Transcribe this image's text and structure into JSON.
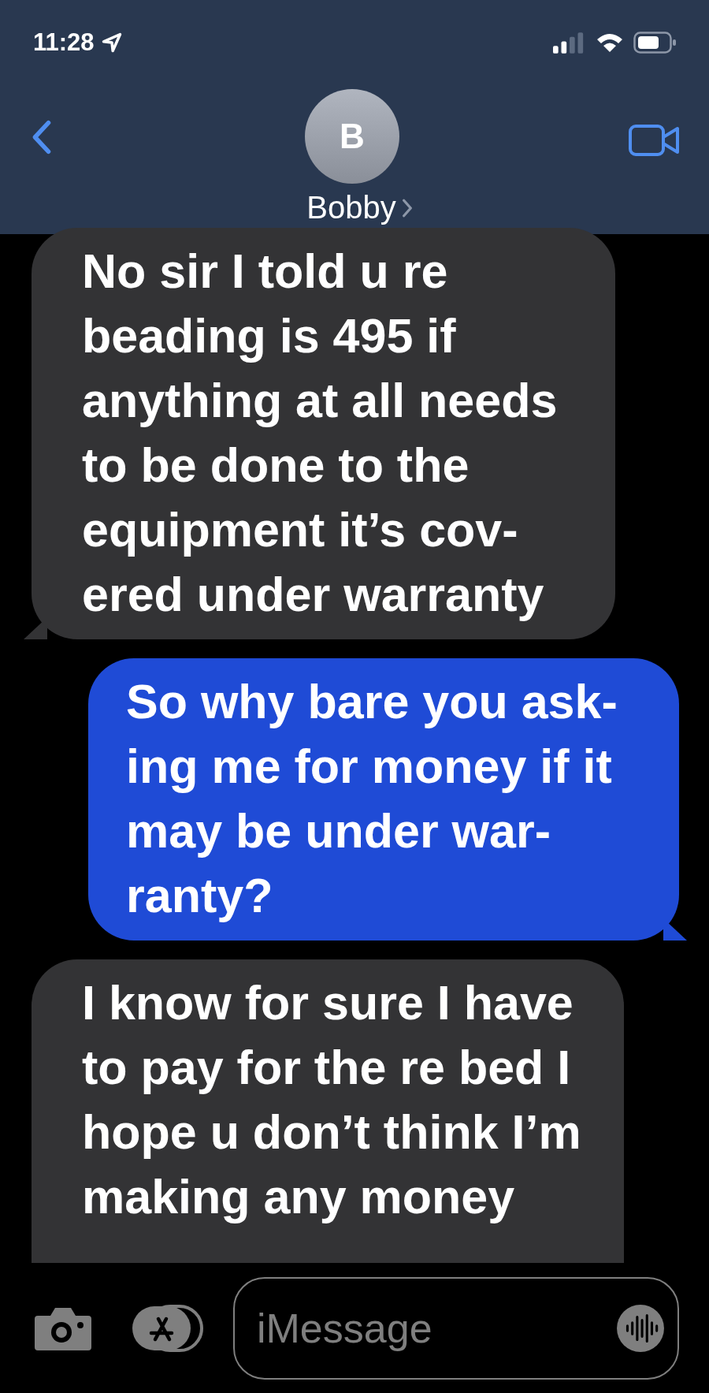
{
  "status_bar": {
    "time": "11:28"
  },
  "header": {
    "avatar_initial": "B",
    "contact_name": "Bobby"
  },
  "messages": [
    {
      "kind": "received",
      "text": "No sir I told u re\nbeading is 495 if\nanything at all needs\nto be done to the\nequipment it’s cov-\nered under warranty"
    },
    {
      "kind": "sent",
      "text": "So why bare you ask-\ning me for money if it\nmay be under war-\nranty?"
    },
    {
      "kind": "received",
      "text": "I know for sure I have\nto pay for the re bed I\nhope u don’t think I’m\nmaking any money"
    }
  ],
  "compose": {
    "placeholder": "iMessage"
  }
}
